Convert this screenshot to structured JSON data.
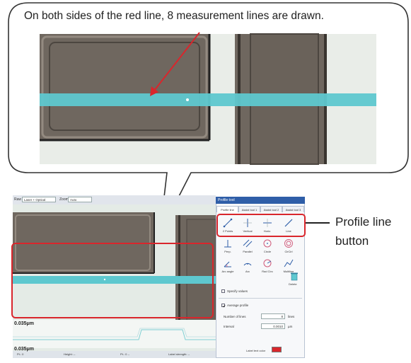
{
  "callout": {
    "text": "On both sides of the red line, 8 measurement lines are drawn."
  },
  "note": {
    "line1": "Profile line",
    "line2": "button"
  },
  "toolbar": {
    "view_label": "Raw",
    "view_value": "Laser + Optical",
    "zoom_label": "Zoom",
    "zoom_value": "Auto"
  },
  "panel": {
    "title": "Profile tool",
    "tabs": [
      "Profile line",
      "Assist tool 1",
      "Assist tool 2",
      "Assist tool 3"
    ],
    "tools": [
      {
        "label": "2 Points",
        "icon": "two-points-line-icon"
      },
      {
        "label": "Vertical",
        "icon": "vertical-line-icon"
      },
      {
        "label": "Horiz.",
        "icon": "horizontal-line-icon"
      },
      {
        "label": "Line",
        "icon": "line-icon"
      },
      {
        "label": "Perp.",
        "icon": "perpendicular-icon"
      },
      {
        "label": "Parallel",
        "icon": "parallel-icon"
      },
      {
        "label": "Circle",
        "icon": "circle-icon"
      },
      {
        "label": "CirCirl",
        "icon": "concentric-circle-icon"
      },
      {
        "label": "Arc angle",
        "icon": "arc-angle-icon"
      },
      {
        "label": "Arc",
        "icon": "arc-icon"
      },
      {
        "label": "Rad Circ",
        "icon": "radial-circle-icon"
      },
      {
        "label": "Multiline",
        "icon": "multiline-icon"
      }
    ],
    "delete_label": "Delete",
    "specify_values": "Specify values",
    "average_profile": "Average profile",
    "number_of_lines_label": "Number of lines",
    "number_of_lines_value": "8",
    "number_of_lines_unit": "lines",
    "interval_label": "Interval",
    "interval_value": "0.0010",
    "interval_unit": "µm",
    "label_color_text": "Label text color"
  },
  "readouts": {
    "top": "0.035μm",
    "bottom": "0.035μm"
  },
  "statusbar": [
    "Pt.: 0",
    "Height: --",
    "Pt.: 0 --",
    "Label strength: --"
  ],
  "colors": {
    "accent_red": "#d9262c",
    "cyan": "#5ec8cf",
    "panel_blue": "#2f5ea8"
  }
}
